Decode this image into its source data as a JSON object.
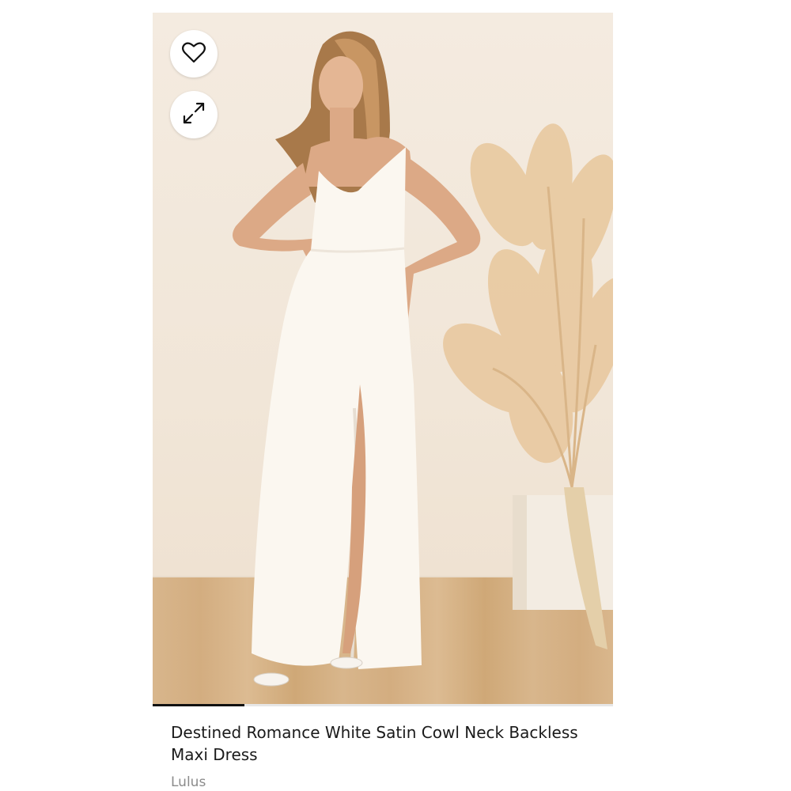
{
  "product": {
    "title": "Destined Romance White Satin Cowl Neck Backless Maxi Dress",
    "brand": "Lulus"
  },
  "gallery": {
    "progress": 0.2,
    "favorite_icon": "heart-outline-icon",
    "expand_icon": "expand-arrows-icon"
  },
  "colors": {
    "text_primary": "#1a1a1a",
    "text_secondary": "#8b8b8b",
    "progress_fill": "#111111"
  }
}
